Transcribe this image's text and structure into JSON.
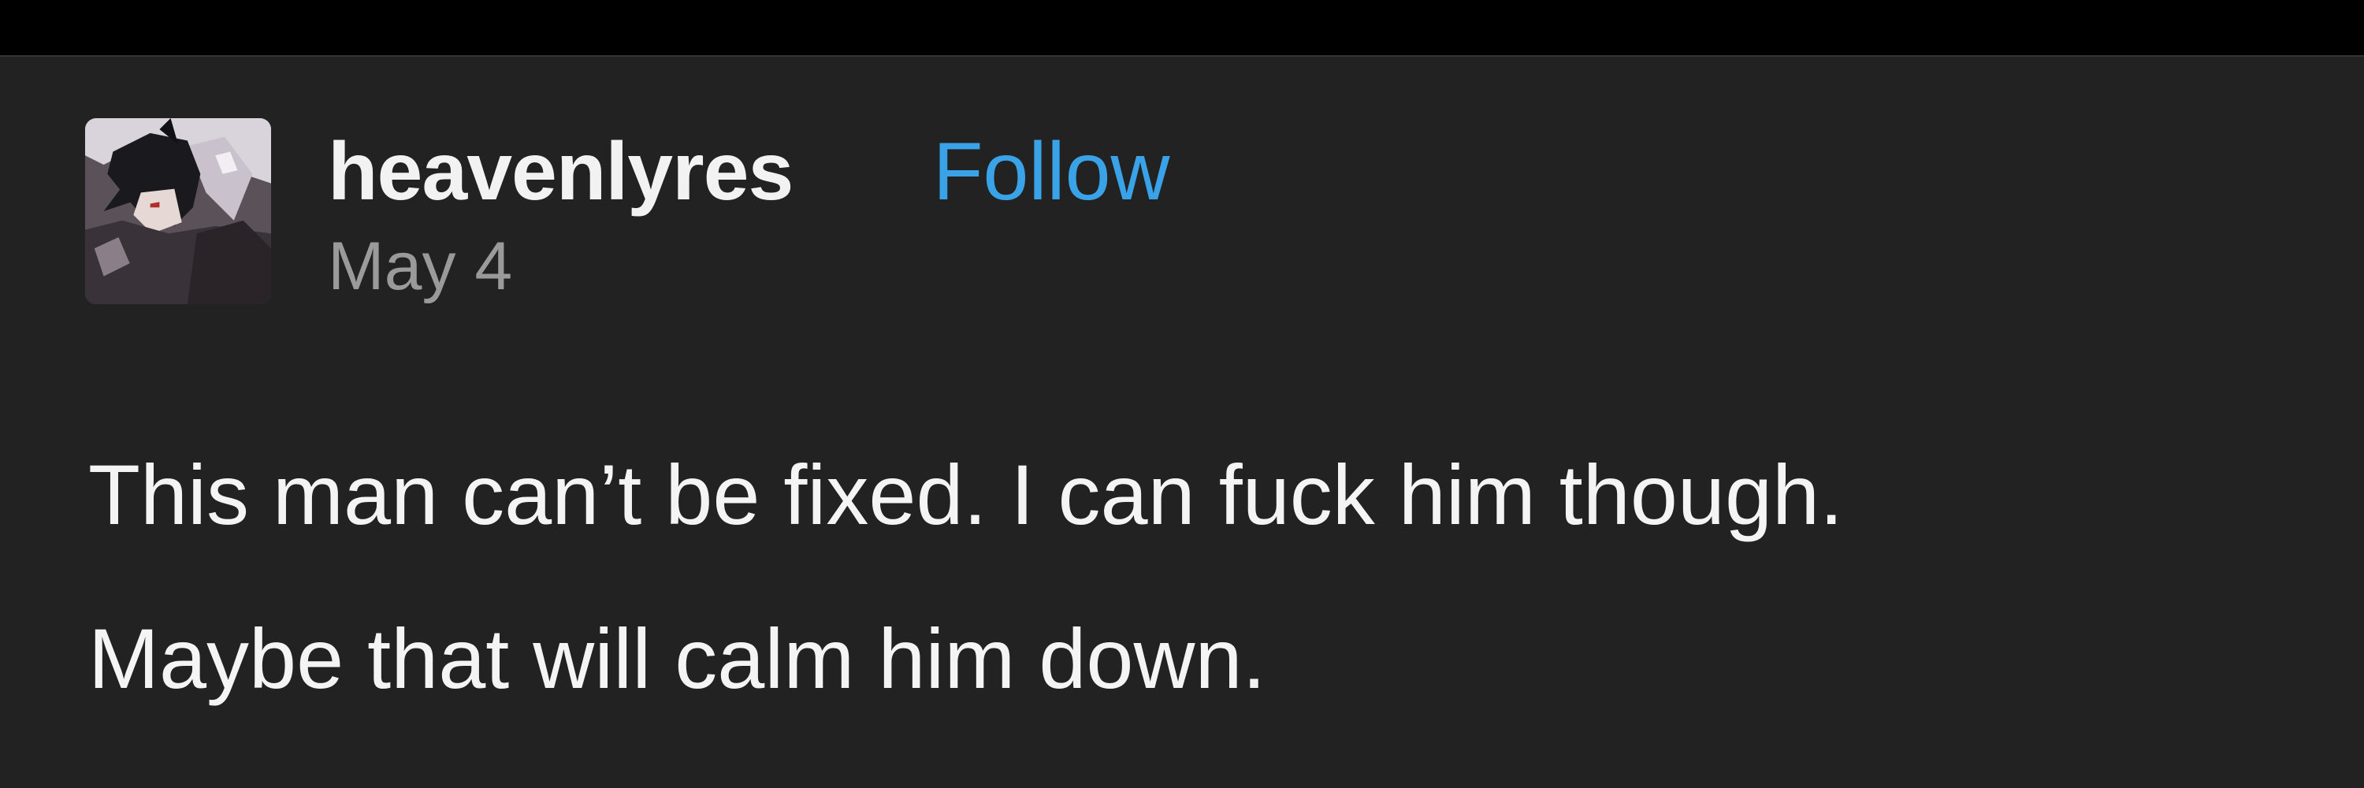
{
  "post": {
    "username": "heavenlyres",
    "follow_label": "Follow",
    "date": "May 4",
    "body_lines": [
      "This man can’t be fixed. I can fuck him though.",
      "Maybe that will calm him down."
    ],
    "avatar_icon": "avatar-image-icon"
  },
  "colors": {
    "background": "#222222",
    "top_bar": "#000000",
    "username": "#f2f2f2",
    "follow": "#3aa3e8",
    "date": "#9a9a9a",
    "body_text": "#f4f4f4"
  }
}
